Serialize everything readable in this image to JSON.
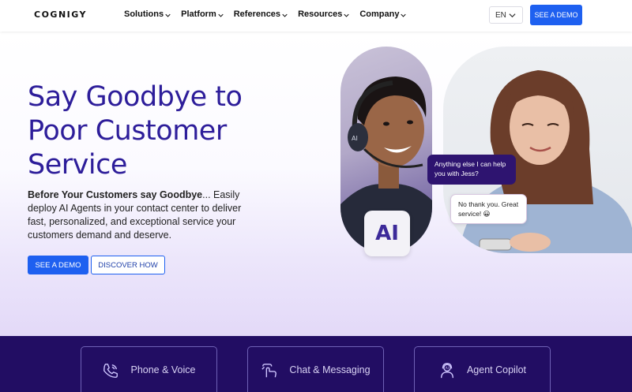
{
  "header": {
    "logo": "COGNIGY",
    "nav": [
      "Solutions",
      "Platform",
      "References",
      "Resources",
      "Company"
    ],
    "language": "EN",
    "cta": "SEE A DEMO"
  },
  "hero": {
    "title": "Say Goodbye to Poor Customer Service",
    "body_bold": "Before Your Customers say Goodbye",
    "body_rest": "... Easily deploy AI Agents in your contact center to deliver fast, personalized, and exceptional service your customers demand and deserve.",
    "primary_button": "SEE A DEMO",
    "secondary_button": "DISCOVER HOW",
    "ai_badge": "AI",
    "chat_agent": "Anything else I can help you with Jess?",
    "chat_customer": "No thank you. Great service! 😀"
  },
  "cards": [
    {
      "label": "Phone & Voice",
      "icon": "phone-voice-icon"
    },
    {
      "label": "Chat & Messaging",
      "icon": "chat-hand-icon"
    },
    {
      "label": "Agent Copilot",
      "icon": "agent-copilot-icon"
    }
  ],
  "colors": {
    "brand_blue": "#1e60f0",
    "title_purple": "#2d1d9a",
    "band_dark": "#220d63"
  }
}
